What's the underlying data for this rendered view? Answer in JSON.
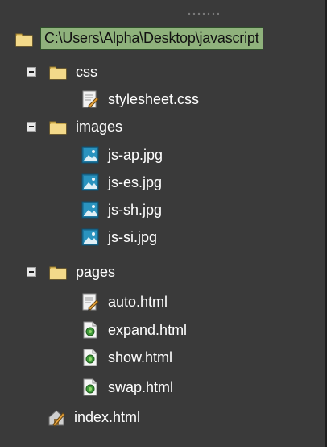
{
  "tree": {
    "root": {
      "label": "C:\\Users\\Alpha\\Desktop\\javascript",
      "icon": "folder-icon"
    },
    "items": [
      {
        "label": "css",
        "icon": "folder-icon",
        "type": "folder",
        "expanded": true,
        "depth": 1
      },
      {
        "label": "stylesheet.css",
        "icon": "css-file-icon",
        "type": "file",
        "depth": 2
      },
      {
        "label": "images",
        "icon": "folder-icon",
        "type": "folder",
        "expanded": true,
        "depth": 1
      },
      {
        "label": "js-ap.jpg",
        "icon": "image-file-icon",
        "type": "file",
        "depth": 2
      },
      {
        "label": "js-es.jpg",
        "icon": "image-file-icon",
        "type": "file",
        "depth": 2
      },
      {
        "label": "js-sh.jpg",
        "icon": "image-file-icon",
        "type": "file",
        "depth": 2
      },
      {
        "label": "js-si.jpg",
        "icon": "image-file-icon",
        "type": "file",
        "depth": 2
      },
      {
        "label": "pages",
        "icon": "folder-icon",
        "type": "folder",
        "expanded": true,
        "depth": 1
      },
      {
        "label": "auto.html",
        "icon": "html-edit-file-icon",
        "type": "file",
        "depth": 2
      },
      {
        "label": "expand.html",
        "icon": "html-file-icon",
        "type": "file",
        "depth": 2
      },
      {
        "label": "show.html",
        "icon": "html-file-icon",
        "type": "file",
        "depth": 2
      },
      {
        "label": "swap.html",
        "icon": "html-file-icon",
        "type": "file",
        "depth": 2
      },
      {
        "label": "index.html",
        "icon": "home-page-icon",
        "type": "file",
        "depth": 1
      }
    ]
  },
  "colors": {
    "panel_bg": "#3a3a3a",
    "root_highlight": "#8fb27c",
    "text": "#ffffff"
  }
}
